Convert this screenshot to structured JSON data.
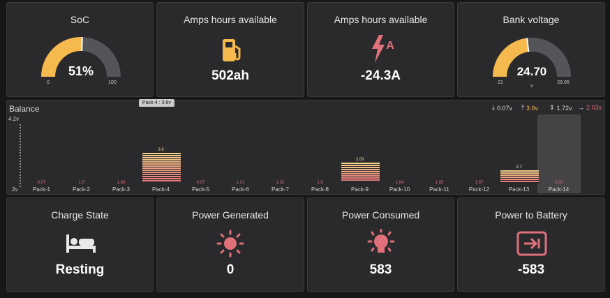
{
  "top_row": {
    "soc": {
      "title": "SoC",
      "value": "51%",
      "percent": 51,
      "min": "0",
      "max": "100"
    },
    "amp_hours": {
      "title": "Amps hours available",
      "value": "502ah",
      "icon": "fuel-pump-icon"
    },
    "current": {
      "title": "Amps hours available",
      "value": "-24.3A",
      "icon": "lightning-amp-icon"
    },
    "bank_voltage": {
      "title": "Bank voltage",
      "value": "24.70",
      "unit": "v",
      "min": "21",
      "max": "29.05",
      "voltage": 24.7
    }
  },
  "balance": {
    "title": "Balance",
    "tooltip": "Pack-4 : 3.6v",
    "axis_top": "4.2v",
    "axis_bottom": "2v",
    "stats": {
      "min": "0.07v",
      "max": "3.6v",
      "spread": "1.72v",
      "last": "2.03v"
    },
    "packs": [
      {
        "name": "Pack-1",
        "label": "0.07",
        "value": 0.07
      },
      {
        "name": "Pack-2",
        "label": "1.5",
        "value": 1.5
      },
      {
        "name": "Pack-3",
        "label": "1.83",
        "value": 1.83
      },
      {
        "name": "Pack-4",
        "label": "3.6",
        "value": 3.6
      },
      {
        "name": "Pack-5",
        "label": "0.07",
        "value": 0.07
      },
      {
        "name": "Pack-6",
        "label": "1.01",
        "value": 1.01
      },
      {
        "name": "Pack-7",
        "label": "1.02",
        "value": 1.02
      },
      {
        "name": "Pack-8",
        "label": "1.8",
        "value": 1.8
      },
      {
        "name": "Pack-9",
        "label": "3.09",
        "value": 3.09
      },
      {
        "name": "Pack-10",
        "label": "1.64",
        "value": 1.64
      },
      {
        "name": "Pack-11",
        "label": "1.85",
        "value": 1.85
      },
      {
        "name": "Pack-12",
        "label": "1.87",
        "value": 1.87
      },
      {
        "name": "Pack-13",
        "label": "2.7",
        "value": 2.7
      },
      {
        "name": "Pack-14",
        "label": "2.03",
        "value": 2.03
      }
    ]
  },
  "bottom_row": {
    "charge_state": {
      "title": "Charge State",
      "value": "Resting",
      "icon": "bed-icon"
    },
    "power_generated": {
      "title": "Power Generated",
      "value": "0",
      "icon": "sun-icon"
    },
    "power_consumed": {
      "title": "Power Consumed",
      "value": "583",
      "icon": "bulb-icon"
    },
    "power_to_battery": {
      "title": "Power to Battery",
      "value": "-583",
      "icon": "sign-in-icon"
    }
  },
  "colors": {
    "accent_yellow": "#f6b94d",
    "accent_red": "#e0707a",
    "gauge_track": "#555559"
  }
}
